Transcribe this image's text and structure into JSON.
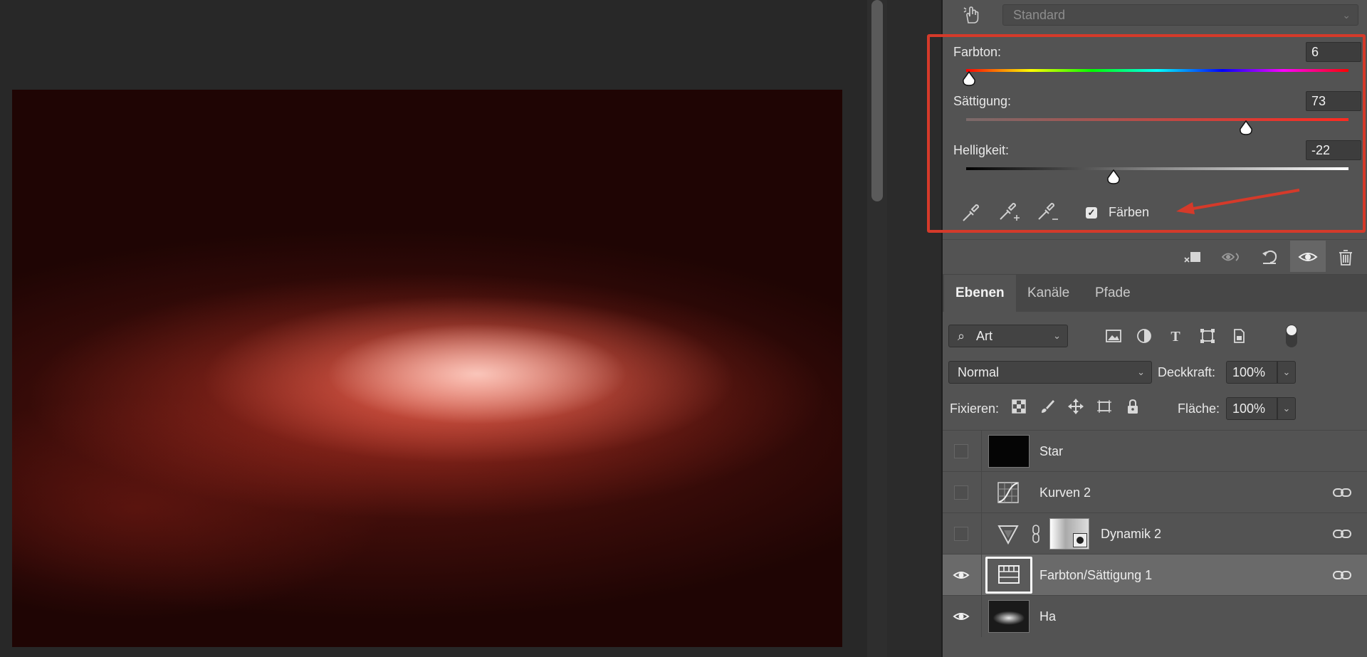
{
  "properties": {
    "preset": "Standard",
    "hue": {
      "label": "Farbton:",
      "value": "6"
    },
    "saturation": {
      "label": "Sättigung:",
      "value": "73"
    },
    "lightness": {
      "label": "Helligkeit:",
      "value": "-22"
    },
    "colorize": {
      "label": "Färben",
      "checked": true
    }
  },
  "layers_panel": {
    "tabs": [
      "Ebenen",
      "Kanäle",
      "Pfade"
    ],
    "filter": {
      "value": "Art"
    },
    "blend_mode": "Normal",
    "opacity": {
      "label": "Deckkraft:",
      "value": "100%"
    },
    "lock": {
      "label": "Fixieren:"
    },
    "fill": {
      "label": "Fläche:",
      "value": "100%"
    },
    "layers": [
      {
        "name": "Star",
        "visible": false,
        "linked": false
      },
      {
        "name": "Kurven 2",
        "visible": false,
        "linked": true
      },
      {
        "name": "Dynamik 2",
        "visible": false,
        "linked": true
      },
      {
        "name": "Farbton/Sättigung 1",
        "visible": true,
        "linked": true,
        "selected": true
      },
      {
        "name": "Ha",
        "visible": true,
        "linked": false
      }
    ]
  },
  "colors": {
    "highlight": "#d53a2a",
    "image_red": "#c8402e"
  }
}
